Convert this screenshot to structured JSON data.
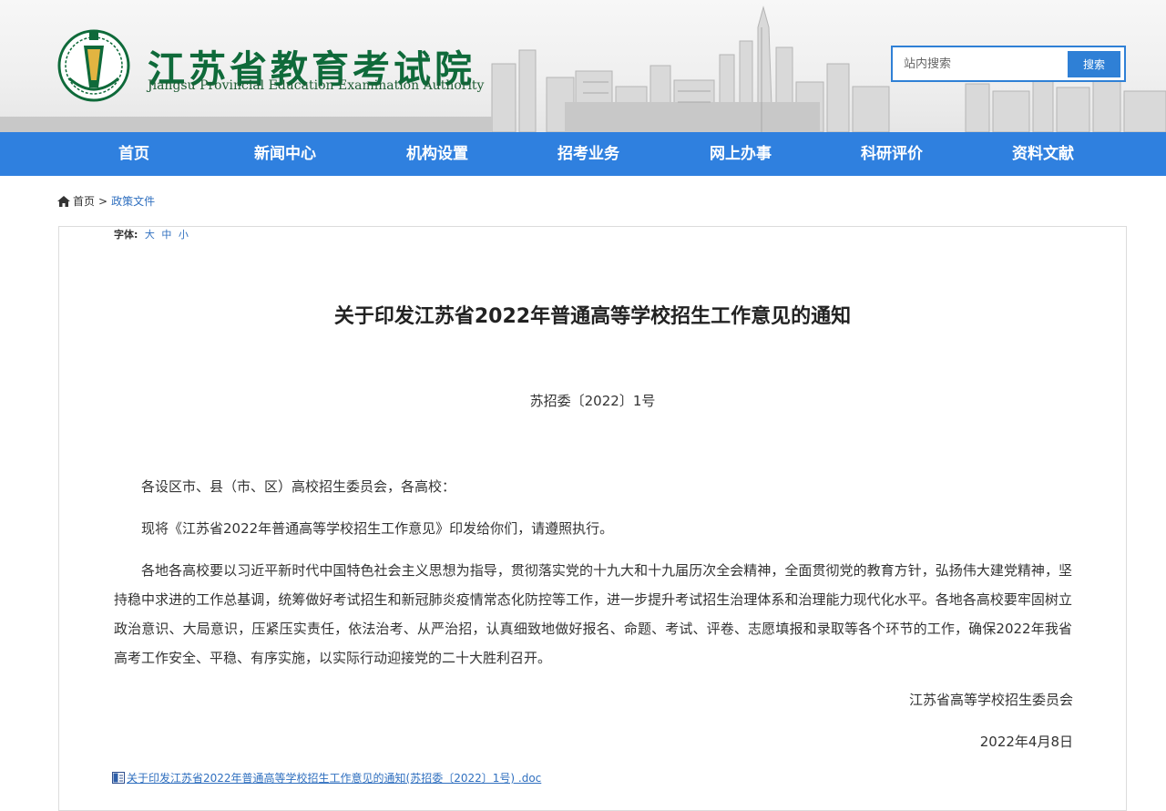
{
  "header": {
    "logo_cn": "江苏省教育考试院",
    "logo_en": "Jiangsu Provincial Education Examination Authority",
    "search": {
      "placeholder": "站内搜索",
      "button_label": "搜索"
    }
  },
  "nav": {
    "items": [
      {
        "label": "首页"
      },
      {
        "label": "新闻中心"
      },
      {
        "label": "机构设置"
      },
      {
        "label": "招考业务"
      },
      {
        "label": "网上办事"
      },
      {
        "label": "科研评价"
      },
      {
        "label": "资料文献"
      }
    ]
  },
  "breadcrumb": {
    "home": "首页",
    "separator": ">",
    "current": "政策文件"
  },
  "font_size": {
    "label": "字体:",
    "options": [
      "大",
      "中",
      "小"
    ]
  },
  "article": {
    "title": "关于印发江苏省2022年普通高等学校招生工作意见的通知",
    "doc_number": "苏招委〔2022〕1号",
    "paragraphs": [
      "各设区市、县（市、区）高校招生委员会，各高校：",
      "现将《江苏省2022年普通高等学校招生工作意见》印发给你们，请遵照执行。",
      "各地各高校要以习近平新时代中国特色社会主义思想为指导，贯彻落实党的十九大和十九届历次全会精神，全面贯彻党的教育方针，弘扬伟大建党精神，坚持稳中求进的工作总基调，统筹做好考试招生和新冠肺炎疫情常态化防控等工作，进一步提升考试招生治理体系和治理能力现代化水平。各地各高校要牢固树立政治意识、大局意识，压紧压实责任，依法治考、从严治招，认真细致地做好报名、命题、考试、评卷、志愿填报和录取等各个环节的工作，确保2022年我省高考工作安全、平稳、有序实施，以实际行动迎接党的二十大胜利召开。"
    ],
    "signer": "江苏省高等学校招生委员会",
    "date": "2022年4月8日",
    "attachment": "关于印发江苏省2022年普通高等学校招生工作意见的通知(苏招委〔2022〕1号) .doc"
  },
  "colors": {
    "nav_bg": "#2f80df",
    "logo_green": "#0f6a3a",
    "link_blue": "#2f6fbf"
  }
}
